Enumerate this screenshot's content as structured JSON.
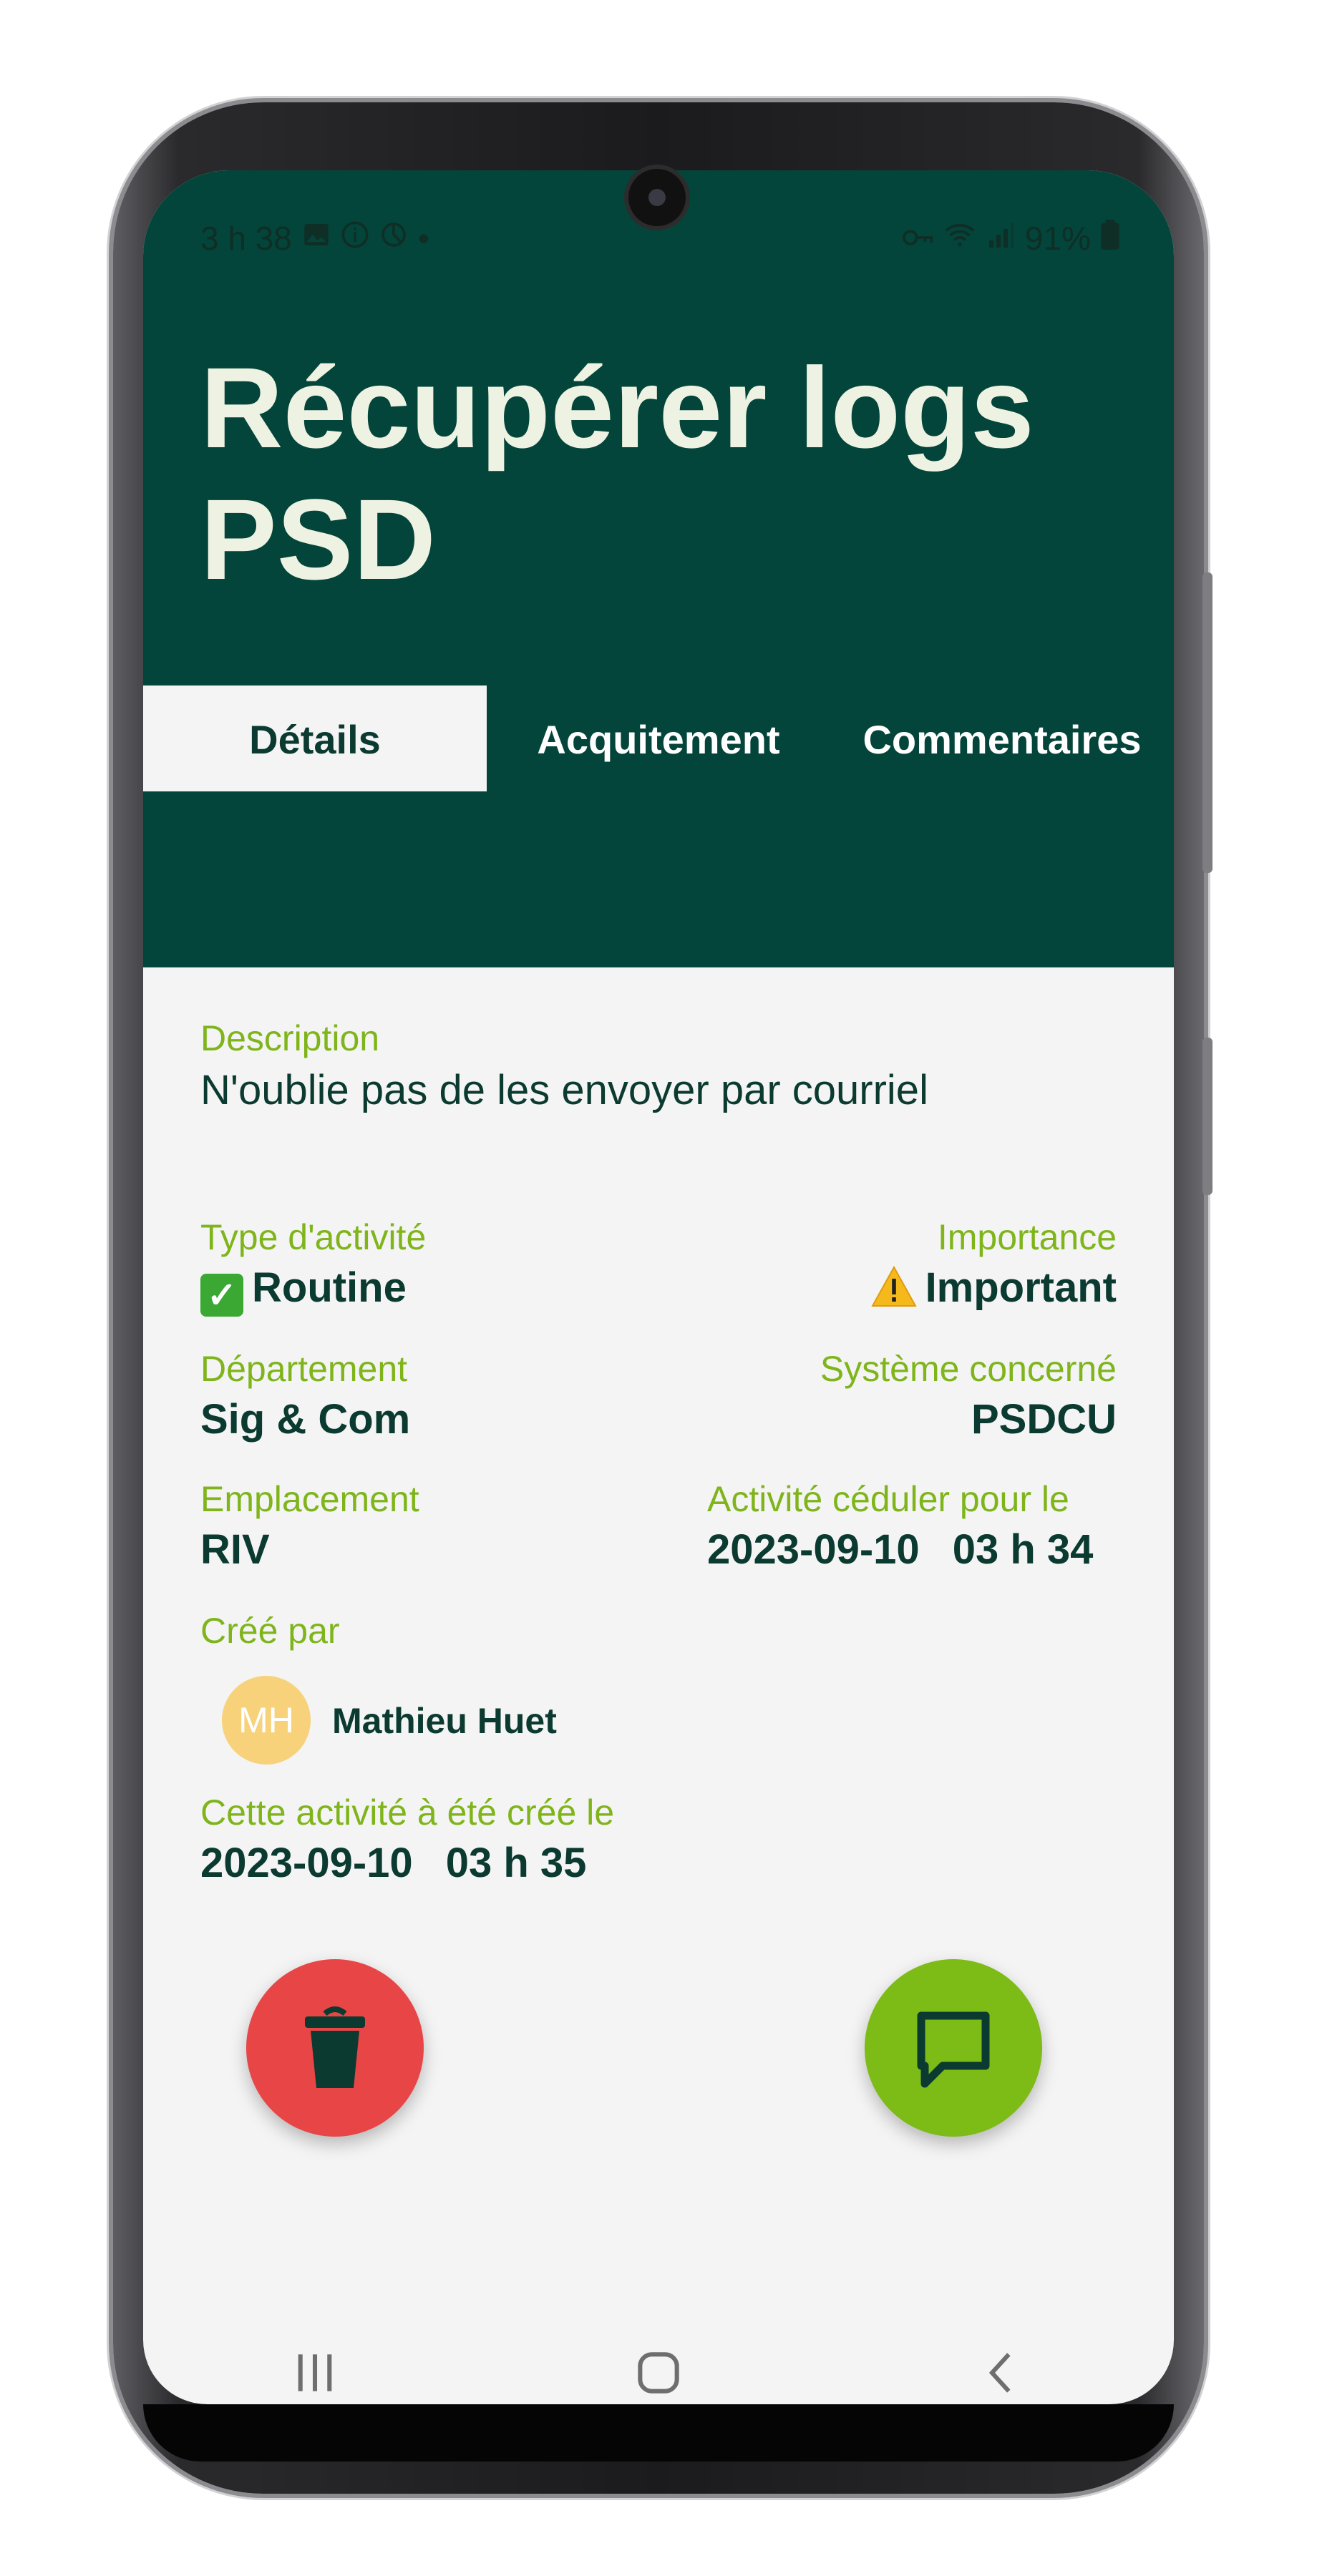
{
  "status_bar": {
    "time": "3 h 38",
    "left_icons": [
      "image-icon",
      "info-icon",
      "sync-icon",
      "dot-icon"
    ],
    "right_icons": [
      "vpn-key-icon",
      "wifi-icon",
      "signal-icon"
    ],
    "battery": "91%"
  },
  "header": {
    "title": "Récupérer logs PSD"
  },
  "tabs": [
    {
      "label": "Détails",
      "active": true
    },
    {
      "label": "Acquitement",
      "active": false
    },
    {
      "label": "Commentaires",
      "active": false
    }
  ],
  "details": {
    "description_label": "Description",
    "description_value": "N'oublie pas de les envoyer par courriel",
    "type_label": "Type d'activité",
    "type_value": "Routine",
    "importance_label": "Importance",
    "importance_value": "Important",
    "department_label": "Département",
    "department_value": "Sig & Com",
    "system_label": "Système concerné",
    "system_value": "PSDCU",
    "location_label": "Emplacement",
    "location_value": "RIV",
    "scheduled_label": "Activité céduler pour le",
    "scheduled_date": "2023-09-10",
    "scheduled_time": "03 h 34",
    "created_by_label": "Créé par",
    "creator_initials": "MH",
    "creator_name": "Mathieu Huet",
    "created_on_label": "Cette activité à été créé le",
    "created_date": "2023-09-10",
    "created_time": "03 h 35"
  },
  "colors": {
    "header_bg": "#03453a",
    "accent_green": "#7fb51b",
    "delete_red": "#e84646",
    "comment_green": "#7dbb16",
    "text_dark": "#0b3a30"
  },
  "nav": [
    "recent-apps-icon",
    "home-icon",
    "back-icon"
  ]
}
